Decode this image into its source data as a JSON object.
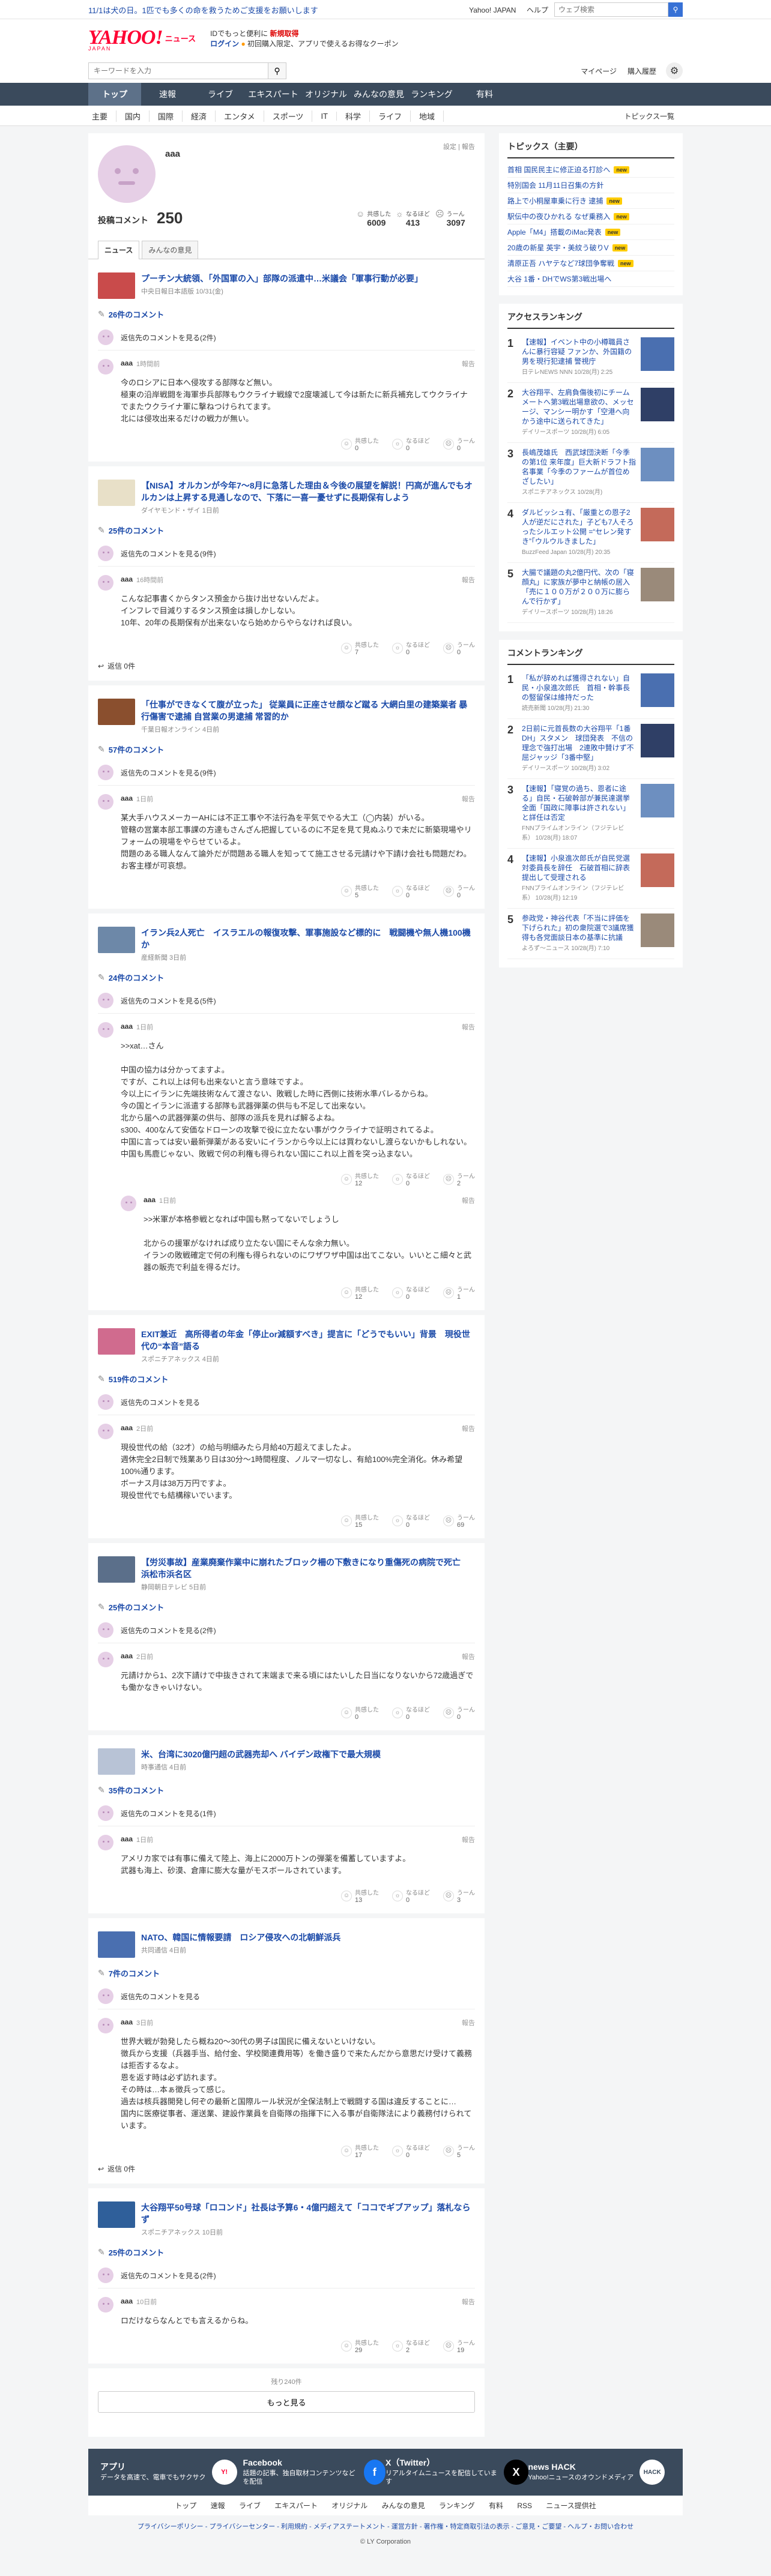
{
  "topstrip": {
    "promo": "11/1は犬の日。1匹でも多くの命を救うためご支援をお願いします",
    "links": [
      "Yahoo! JAPAN",
      "ヘルプ"
    ],
    "search_placeholder": "ウェブ検索"
  },
  "header": {
    "logo": "YAHOO!",
    "logo_japan": "JAPAN",
    "logo_sub": "ニュース",
    "line1_a": "IDでもっと便利に",
    "line1_b": "新規取得",
    "login": "ログイン",
    "line2": "初回購入限定、アプリで使えるお得なクーポン"
  },
  "searchrow": {
    "placeholder": "キーワードを入力",
    "mypage": "マイページ",
    "purchase": "購入履歴"
  },
  "nav1": [
    "トップ",
    "速報",
    "ライブ",
    "エキスパート",
    "オリジナル",
    "みんなの意見",
    "ランキング",
    "有料"
  ],
  "nav2": [
    "主要",
    "国内",
    "国際",
    "経済",
    "エンタメ",
    "スポーツ",
    "IT",
    "科学",
    "ライフ",
    "地域"
  ],
  "nav2_right": "トピックス一覧",
  "profile": {
    "name": "aaa",
    "edit": "設定 | 報告",
    "post_label": "投稿コメント",
    "post_count": "250",
    "stats": [
      {
        "label": "共感した",
        "value": "6009"
      },
      {
        "label": "なるほど",
        "value": "413"
      },
      {
        "label": "うーん",
        "value": "3097"
      }
    ]
  },
  "tabs": [
    "ニュース",
    "みんなの意見"
  ],
  "ui": {
    "reply_label": "返信先のコメントを見る",
    "report": "報告",
    "r1": "共感した",
    "r2": "なるほど",
    "r3": "うーん",
    "more_replies": "返信 0件",
    "more_count": "残り240件",
    "more_btn": "もっと見る"
  },
  "cards": [
    {
      "title": "プーチン大統領、「外国軍の入」部隊の派遣中…米議会「軍事行動が必要」",
      "source": "中央日報日本語版 10/31(金)",
      "comments": "26件のコメント",
      "reply": "返信先のコメントを見る(2件)",
      "user": "aaa",
      "time": "1時間前",
      "text": "今のロシアに日本へ侵攻する部隊など無い。\n極東の沿岸戦闘を海軍歩兵部隊もウクライナ戦線で2度壊滅して今は新たに新兵補充してウクライナでまたウクライナ軍に撃ねつけられてます。\n北には侵攻出来るだけの戦力が無い。",
      "r": [
        "0",
        "0",
        "0"
      ]
    },
    {
      "title": "【NISA】オルカンが今年7〜8月に急落した理由＆今後の展望を解説！円高が進んでもオルカンは上昇する見通しなので、下落に一喜一憂せずに長期保有しよう",
      "source": "ダイヤモンド・ザイ 1日前",
      "comments": "25件のコメント",
      "reply": "返信先のコメントを見る(9件)",
      "user": "aaa",
      "time": "16時間前",
      "text": "こんな記事書くからタンス預金から抜け出せないんだよ。\nインフレで目減りするタンス預金は損しかしない。\n10年、20年の長期保有が出来ないなら始めからやらなければ良い。",
      "r": [
        "7",
        "0",
        "0"
      ],
      "more": "返信 0件"
    },
    {
      "title": "「仕事ができなくて腹が立った」 従業員に正座させ顔など蹴る 大網白里の建築業者 暴行傷害で逮捕 自営業の男逮捕 常習的か",
      "source": "千葉日報オンライン 4日前",
      "comments": "57件のコメント",
      "reply": "返信先のコメントを見る(9件)",
      "user": "aaa",
      "time": "1日前",
      "text": "某大手ハウスメーカーAHには不正工事や不法行為を平気でやる大工（◯内装）がいる。\n管轄の営業本部工事課の方達もさんざん把握しているのに不足を見て見ぬふりで未だに新築現場やリフォームの現場をやらせているよ。\n問題のある職人なんて論外だが問題ある職人を知ってて施工させる元請けや下請け会社も問題だわ。\nお客主様が可哀想。",
      "r": [
        "5",
        "0",
        "0"
      ]
    },
    {
      "title": "イラン兵2人死亡　イスラエルの報復攻撃、軍事施設など標的に　戦闘機や無人機100機か",
      "source": "産経新聞 3日前",
      "comments": "24件のコメント",
      "reply": "返信先のコメントを見る(5件)",
      "user": "aaa",
      "time": "1日前",
      "text": ">>xat…さん\n\n中国の協力は分かってますよ。\nですが、これ以上は何も出来ないと言う意味ですよ。\n今以上にイランに先端技術なんて渡さない、敗戦した時に西側に技術水準バレるからね。\n今の国とイランに派遣する部隊も武器弾薬の供与も不足して出来ない。\n北から届への武器弾薬の供与、部隊の派兵を見れば解るよね。\ns300、400なんて安価なドローンの攻撃で役に立たない事がウクライナで証明されてるよ。\n中国に言っては安い最新弾薬がある安いにイランから今以上には買わないし渡らないかもしれない。\n中国も馬鹿じゃない、敗戦で何の利権も得られない国にこれ以上首を突っ込まない。",
      "r": [
        "12",
        "0",
        "2"
      ],
      "nested": {
        "user": "aaa",
        "time": "1日前",
        "text": ">>米軍が本格参戦となれば中国も黙ってないでしょうし\n\n北からの援軍がなければ成り立たない国にそんな余力無い。\nイランの敗戦確定で何の利権も得られないのにワザワザ中国は出てこない。いいとこ細々と武器の販売で利益を得るだけ。",
        "r": [
          "12",
          "0",
          "1"
        ]
      }
    },
    {
      "title": "EXIT兼近　高所得者の年金「停止or減額すべき」提言に「どうでもいい」背景　現役世代の“本音”語る",
      "source": "スポニチアネックス 4日前",
      "comments": "519件のコメント",
      "reply": "返信先のコメントを見る",
      "user": "aaa",
      "time": "2日前",
      "text": "現役世代の給（32才）の給与明細みたら月給40万超えてましたよ。\n週休完全2日制で残業あり日は30分〜1時間程度、ノルマ一切なし、有給100%完全消化。休み希望100%通ります。\nボーナス月は38万万円ですよ。\n現役世代でも結構稼いでいます。",
      "r": [
        "15",
        "0",
        "69"
      ]
    },
    {
      "title": "【労災事故】産業廃棄作業中に崩れたブロック柵の下敷きになり重傷死の病院で死亡　浜松市浜名区",
      "source": "静岡朝日テレビ 5日前",
      "comments": "25件のコメント",
      "reply": "返信先のコメントを見る(2件)",
      "user": "aaa",
      "time": "2日前",
      "text": "元請けから1、2次下請けで中抜きされて末端まで来る頃にはたいした日当になりないから72歳過ぎでも働かなきゃいけない。",
      "r": [
        "0",
        "0",
        "0"
      ]
    },
    {
      "title": "米、台湾に3020億円超の武器売却へ バイデン政権下で最大規模",
      "source": "時事通信 4日前",
      "comments": "35件のコメント",
      "reply": "返信先のコメントを見る(1件)",
      "user": "aaa",
      "time": "1日前",
      "text": "アメリカ家では有事に備えて陸上、海上に2000万トンの弾薬を備蓄していますよ。\n武器も海上、砂漠、倉庫に膨大な量がモスボールされています。",
      "r": [
        "13",
        "0",
        "3"
      ]
    },
    {
      "title": "NATO、韓国に情報要請　ロシア侵攻への北朝鮮派兵",
      "source": "共同通信 4日前",
      "comments": "7件のコメント",
      "reply": "返信先のコメントを見る",
      "user": "aaa",
      "time": "3日前",
      "text": "世界大戦が勃発したら概ね20〜30代の男子は国民に備えないといけない。\n徴兵から支援（兵器手当、給付金、学校関連費用等）を働き盛りで来たんだから意思だけ受けて義務は拒否するなよ。\n恩を返す時は必ず訪れます。\nその時は…本ぁ徴兵って感じ。\n過去は核兵器開発し何ぞの最新と国際ルール状況が全保法制上で戦闘する国は違反することに…\n国内に医療従事者、運送業、建設作業員を自衛隊の指揮下に入る事が自衛隊法により義務付けられています。",
      "r": [
        "17",
        "0",
        "5"
      ],
      "more": "返信 0件"
    },
    {
      "title": "大谷翔平50号球「ロコンド」社長は予算6・4億円超えて「ココでギブアップ」落札ならず",
      "source": "スポニチアネックス 10日前",
      "comments": "25件のコメント",
      "reply": "返信先のコメントを見る(2件)",
      "user": "aaa",
      "time": "10日前",
      "text": "ロだけならなんとでも言えるからね。",
      "r": [
        "29",
        "2",
        "19"
      ]
    }
  ],
  "side": {
    "topics_title": "トピックス（主要）",
    "topics": [
      {
        "text": "首相 国民民主に修正迫る打診へ",
        "badge": "new"
      },
      {
        "text": "特別国会 11月11日召集の方針",
        "badge": ""
      },
      {
        "text": "路上で小桐屋車乗に行き 逮捕",
        "badge": "new"
      },
      {
        "text": "駅伝中の夜ひかれる なぜ乗務入",
        "badge": "new"
      },
      {
        "text": "Apple「M4」搭載のiMac発表",
        "badge": "new"
      },
      {
        "text": "20歳の新星 英宇・美紋う破りV",
        "badge": "new"
      },
      {
        "text": "清原正吾 ハヤテなど7球団争奪戦",
        "badge": "new"
      },
      {
        "text": "大谷 1番・DHでWS第3戦出場へ",
        "badge": ""
      }
    ],
    "access_title": "アクセスランキング",
    "access": [
      {
        "text": "【速報】イベント中の小樽職員さんに暴行容疑 ファンか、外国籍の男を現行犯逮捕 警視庁",
        "src": "日テレNEWS NNN 10/28(月) 2:25"
      },
      {
        "text": "大谷翔平、左肩負傷後初にチームメートへ第3戦出場意欲の、メッセージ、マンシー明かす「空港へ向かう途中に送られてきた」",
        "src": "デイリースポーツ 10/28(月) 6:05"
      },
      {
        "text": "長嶋茂雄氏　西武球団決断「今季の第1位 来年度」巨大新ドラフト指名事業「今季のファームが首位めざしたい」",
        "src": "スポニチアネックス 10/28(月)"
      },
      {
        "text": "ダルビッシュ有、「厳重との恩子2人が逆だにされた」子ども7人そろったシルエット公開 =“セレン発すき”「ウルウルきました」",
        "src": "BuzzFeed Japan 10/28(月) 20:35"
      },
      {
        "text": "大腸で議題の丸2億円代、次の「寝顔丸」に家族が夢中と納帳の居入「売に１００万が２００万に膨らんで行かず」",
        "src": "デイリースポーツ 10/28(月) 18:26"
      }
    ],
    "comment_title": "コメントランキング",
    "comment": [
      {
        "text": "「私が辞めれば獲得されない」自民・小泉進次郎氏　首相・幹事長の竪留保は維持だった",
        "src": "読売新聞 10/28(月) 21:30"
      },
      {
        "text": "2日前に元首長数の大谷翔平「1番DH」スタメン　球団発表　不信の理念で強打出場　2連敗中賛けず不屈ジャッジ「3番中堅」",
        "src": "デイリースポーツ 10/28(月) 3:02"
      },
      {
        "text": "【速報】「寝覚の過ち、恩者に途る」自民・石破幹部が兼民達選挙全面「国政に障事は許されない」と詳任は否定",
        "src": "FNNプライムオンライン（フジテレビ系） 10/28(月) 18:07"
      },
      {
        "text": "【速報】小泉進次郎氏が自民党選対委員長を辞任　石破首相に辞表提出して受理される",
        "src": "FNNプライムオンライン（フジテレビ系） 10/28(月) 12:19"
      },
      {
        "text": "参政党・神谷代表「不当に評価を下げられた」初の衆院選で3議席獲得も各党面談日本の基準に抗議",
        "src": "よろず〜ニュース 10/28(月) 7:10"
      }
    ]
  },
  "footer": {
    "apps": [
      {
        "title": "アプリ",
        "desc": "データを高速で、電車でもサクサク"
      },
      {
        "title": "Facebook",
        "desc": "話題の記事、独自取材コンテンツなどを配信"
      },
      {
        "title": "X（Twitter）",
        "desc": "リアルタイムニュースを配信しています"
      },
      {
        "title": "news HACK",
        "desc": "Yahoo!ニュースのオウンドメディア"
      }
    ],
    "links": [
      "トップ",
      "速報",
      "ライブ",
      "エキスパート",
      "オリジナル",
      "みんなの意見",
      "ランキング",
      "有料",
      "RSS",
      "ニュース提供社"
    ],
    "legal": "プライバシーポリシー - プライバシーセンター - 利用規約 - メディアステートメント - 運営方針 - 著作権・特定商取引法の表示 - ご意見・ご要望 - ヘルプ・お問い合わせ",
    "copyright": "© LY Corporation"
  }
}
